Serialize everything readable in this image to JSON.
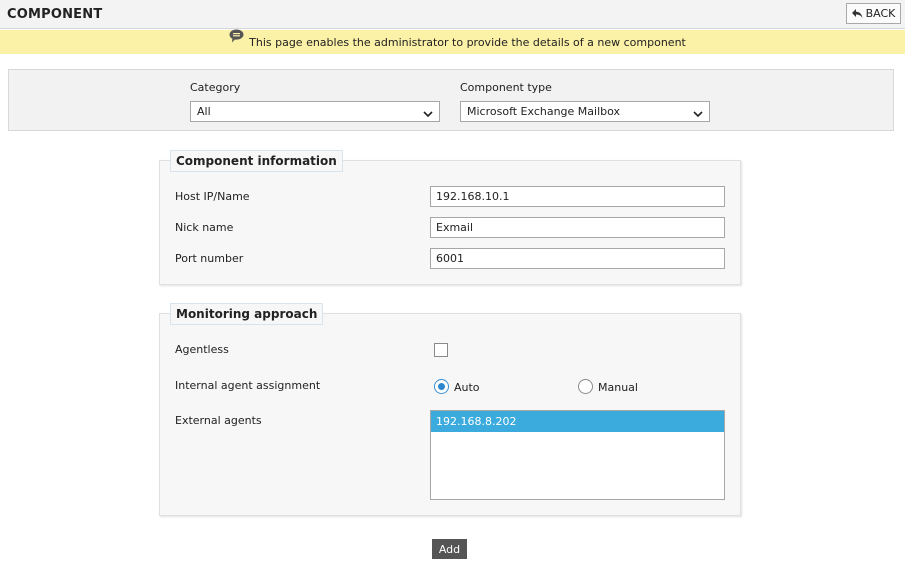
{
  "header": {
    "title": "COMPONENT",
    "back_label": "BACK"
  },
  "info": {
    "message": "This page enables the administrator to provide the details of a new component",
    "icon": "speech-bubble-icon"
  },
  "filters": {
    "category_label": "Category",
    "category_value": "All",
    "component_type_label": "Component type",
    "component_type_value": "Microsoft Exchange Mailbox"
  },
  "component_info": {
    "legend": "Component information",
    "host_label": "Host IP/Name",
    "host_value": "192.168.10.1",
    "nick_label": "Nick name",
    "nick_value": "Exmail",
    "port_label": "Port number",
    "port_value": "6001"
  },
  "monitoring": {
    "legend": "Monitoring approach",
    "agentless_label": "Agentless",
    "agentless_checked": false,
    "assignment_label": "Internal agent assignment",
    "assignment_options": [
      "Auto",
      "Manual"
    ],
    "assignment_selected": "Auto",
    "external_label": "External agents",
    "external_agents": [
      "192.168.8.202"
    ],
    "external_selected": "192.168.8.202"
  },
  "actions": {
    "add_label": "Add"
  },
  "colors": {
    "info_bar": "#fbf1a7",
    "selection": "#3aabdc",
    "radio_accent": "#2e86cf",
    "add_button": "#555555"
  }
}
